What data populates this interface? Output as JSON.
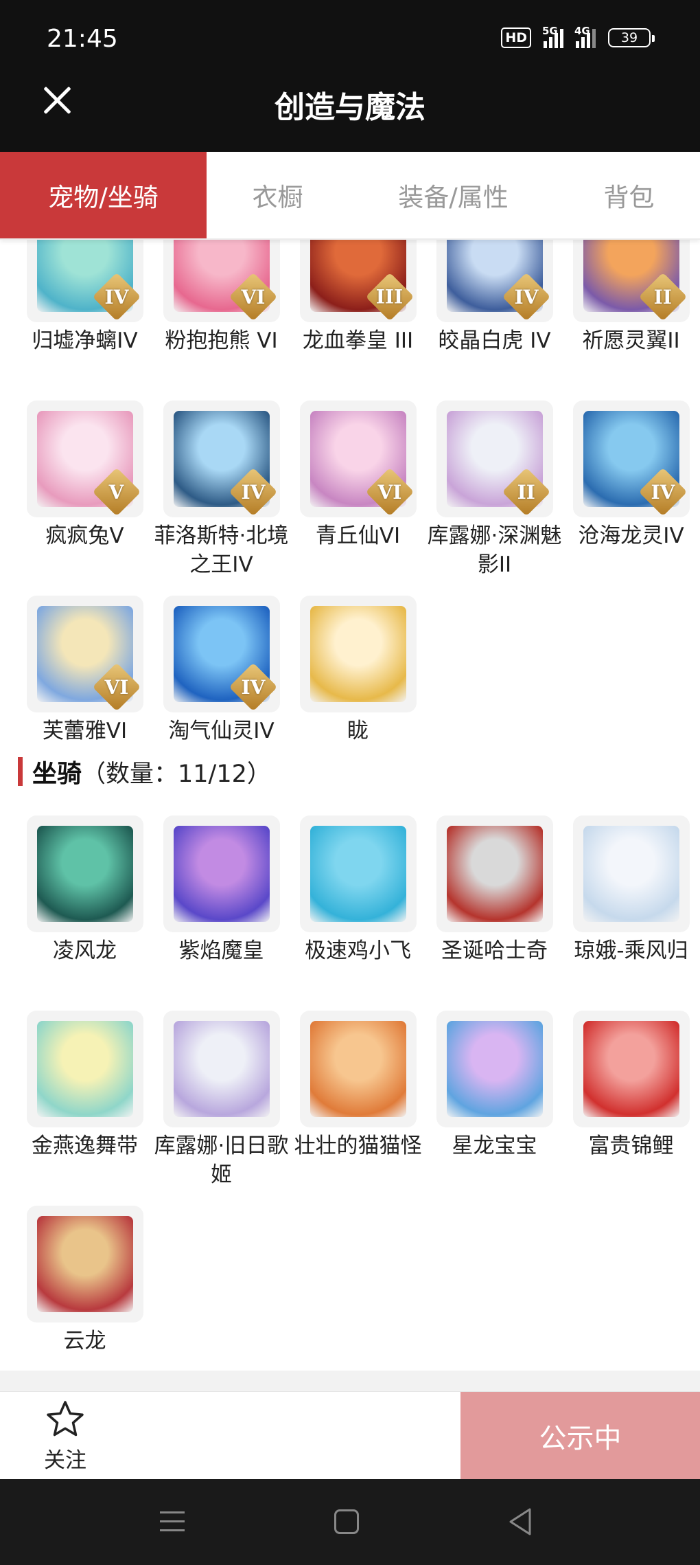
{
  "status_bar": {
    "time": "21:45",
    "hd": "HD",
    "net1": "5G",
    "net2": "4G",
    "battery": "39"
  },
  "header": {
    "title": "创造与魔法"
  },
  "tabs": [
    {
      "label": "宠物/坐骑",
      "active": true
    },
    {
      "label": "衣橱",
      "active": false
    },
    {
      "label": "装备/属性",
      "active": false
    },
    {
      "label": "背包",
      "active": false
    }
  ],
  "pets": [
    {
      "name": "归墟净螭IV",
      "rank": "IV",
      "colors": [
        "#9fe3d6",
        "#4fb3c9"
      ]
    },
    {
      "name": "粉抱抱熊 VI",
      "rank": "VI",
      "colors": [
        "#f7b7c9",
        "#e7688f"
      ]
    },
    {
      "name": "龙血拳皇 III",
      "rank": "III",
      "colors": [
        "#e06a3a",
        "#8c1f1a"
      ]
    },
    {
      "name": "皎晶白虎 IV",
      "rank": "IV",
      "colors": [
        "#c9dcf3",
        "#3e5e9c"
      ]
    },
    {
      "name": "祈愿灵翼II",
      "rank": "II",
      "colors": [
        "#f3a45c",
        "#7b5aa9"
      ]
    },
    {
      "name": "疯疯兔V",
      "rank": "V",
      "colors": [
        "#fbe4ef",
        "#e89bbd"
      ]
    },
    {
      "name": "菲洛斯特·北境之王IV",
      "rank": "IV",
      "colors": [
        "#a9d8f5",
        "#2e5b86"
      ]
    },
    {
      "name": "青丘仙VI",
      "rank": "VI",
      "colors": [
        "#f9d4e8",
        "#c886c2"
      ]
    },
    {
      "name": "库露娜·深渊魅影II",
      "rank": "II",
      "colors": [
        "#eef0f7",
        "#c9a4d8"
      ]
    },
    {
      "name": "沧海龙灵IV",
      "rank": "IV",
      "colors": [
        "#86c9ef",
        "#2b6cb0"
      ]
    },
    {
      "name": "芙蕾雅VI",
      "rank": "VI",
      "colors": [
        "#f4e6b8",
        "#7fa8df"
      ]
    },
    {
      "name": "淘气仙灵IV",
      "rank": "IV",
      "colors": [
        "#7cc4f5",
        "#1f63c0"
      ]
    },
    {
      "name": "眬",
      "rank": "",
      "colors": [
        "#fff1cf",
        "#e7b94a"
      ]
    }
  ],
  "mount_section": {
    "title": "坐骑",
    "count_text": "（数量：11/12）"
  },
  "mounts": [
    {
      "name": "凌风龙",
      "colors": [
        "#5fc2a7",
        "#1e5a52"
      ]
    },
    {
      "name": "紫焰魔皇",
      "colors": [
        "#c28be3",
        "#5a48c9"
      ]
    },
    {
      "name": "极速鸡小飞",
      "colors": [
        "#7fd6ef",
        "#34b2d9"
      ]
    },
    {
      "name": "圣诞哈士奇",
      "colors": [
        "#d9d9d9",
        "#b5342d"
      ]
    },
    {
      "name": "琼娥-乘风归",
      "colors": [
        "#f3f6fb",
        "#c6d9ec"
      ]
    },
    {
      "name": "金燕逸舞带",
      "colors": [
        "#f6f2b5",
        "#8fd6c9"
      ]
    },
    {
      "name": "库露娜·旧日歌姬",
      "colors": [
        "#eef0f7",
        "#b8a7dd"
      ]
    },
    {
      "name": "壮壮的猫猫怪",
      "colors": [
        "#f7c68f",
        "#e07b39"
      ]
    },
    {
      "name": "星龙宝宝",
      "colors": [
        "#d9b5f2",
        "#5fa4e0"
      ]
    },
    {
      "name": "富贵锦鲤",
      "colors": [
        "#f3a19c",
        "#d1302e"
      ]
    },
    {
      "name": "云龙",
      "colors": [
        "#e9c48a",
        "#b83a3e"
      ]
    }
  ],
  "bottom": {
    "follow_label": "关注",
    "notice_label": "公示中"
  },
  "theme": {
    "accent": "#c9393a",
    "notice_bg": "#e29a9b"
  }
}
